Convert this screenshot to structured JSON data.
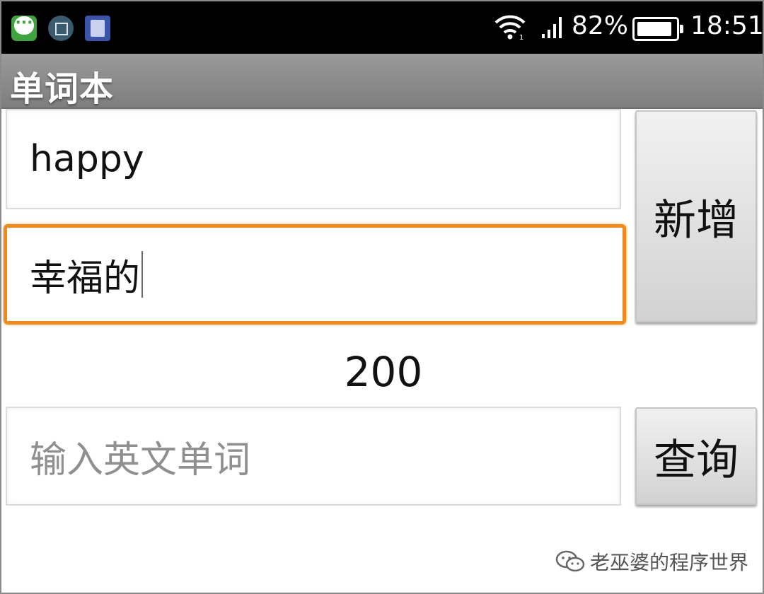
{
  "status_bar": {
    "notification_icons": [
      "message-icon",
      "gallery-icon",
      "shopping-bag-icon"
    ],
    "battery_percent": "82%",
    "time": "18:51"
  },
  "app": {
    "title": "单词本"
  },
  "form": {
    "word_value": "happy",
    "meaning_value": "幸福的",
    "add_button_label": "新增",
    "word_count": "200",
    "query_placeholder": "输入英文单词",
    "query_value": "",
    "search_button_label": "查询"
  },
  "watermark": {
    "text": "老巫婆的程序世界"
  },
  "colors": {
    "focus_border": "#f08a1c",
    "title_bar": "#8a8a8a",
    "status_bar": "#000000"
  }
}
